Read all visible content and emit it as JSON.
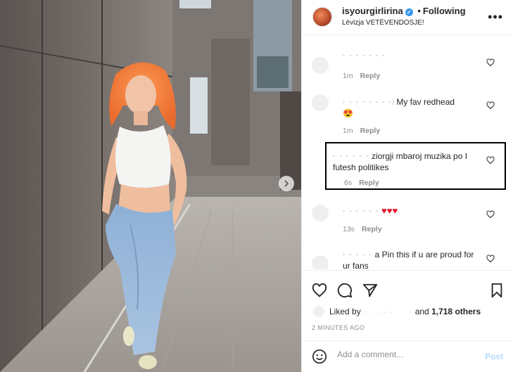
{
  "header": {
    "username": "isyourgirlirina",
    "follow_status": "Following",
    "separator": "•",
    "location": "Lëvizja VETËVENDOSJE!"
  },
  "comments": [
    {
      "user": "",
      "text": "",
      "time": "1m",
      "reply": "Reply"
    },
    {
      "user": "i",
      "text": "My fav redhead",
      "emoji": "😍",
      "time": "1m",
      "reply": "Reply"
    },
    {
      "user": "",
      "text": "ziorgji mbaroj muzika po I futesh politikes",
      "time": "6s",
      "reply": "Reply",
      "highlighted": true
    },
    {
      "user": "",
      "text": "♥♥♥",
      "time": "13s",
      "reply": "Reply"
    },
    {
      "user": "",
      "text": "a Pin this if u are proud for ur fans",
      "time": "",
      "reply": ""
    }
  ],
  "likes": {
    "prefix": "Liked by",
    "middle": "and",
    "count": "1,718 others"
  },
  "post_time": "2 MINUTES AGO",
  "add_comment": {
    "placeholder": "Add a comment...",
    "post_label": "Post"
  },
  "colors": {
    "accent": "#3897f0",
    "post_disabled": "#b3dbff",
    "hair": "#f47a3a",
    "highlight_border": "#000000"
  }
}
